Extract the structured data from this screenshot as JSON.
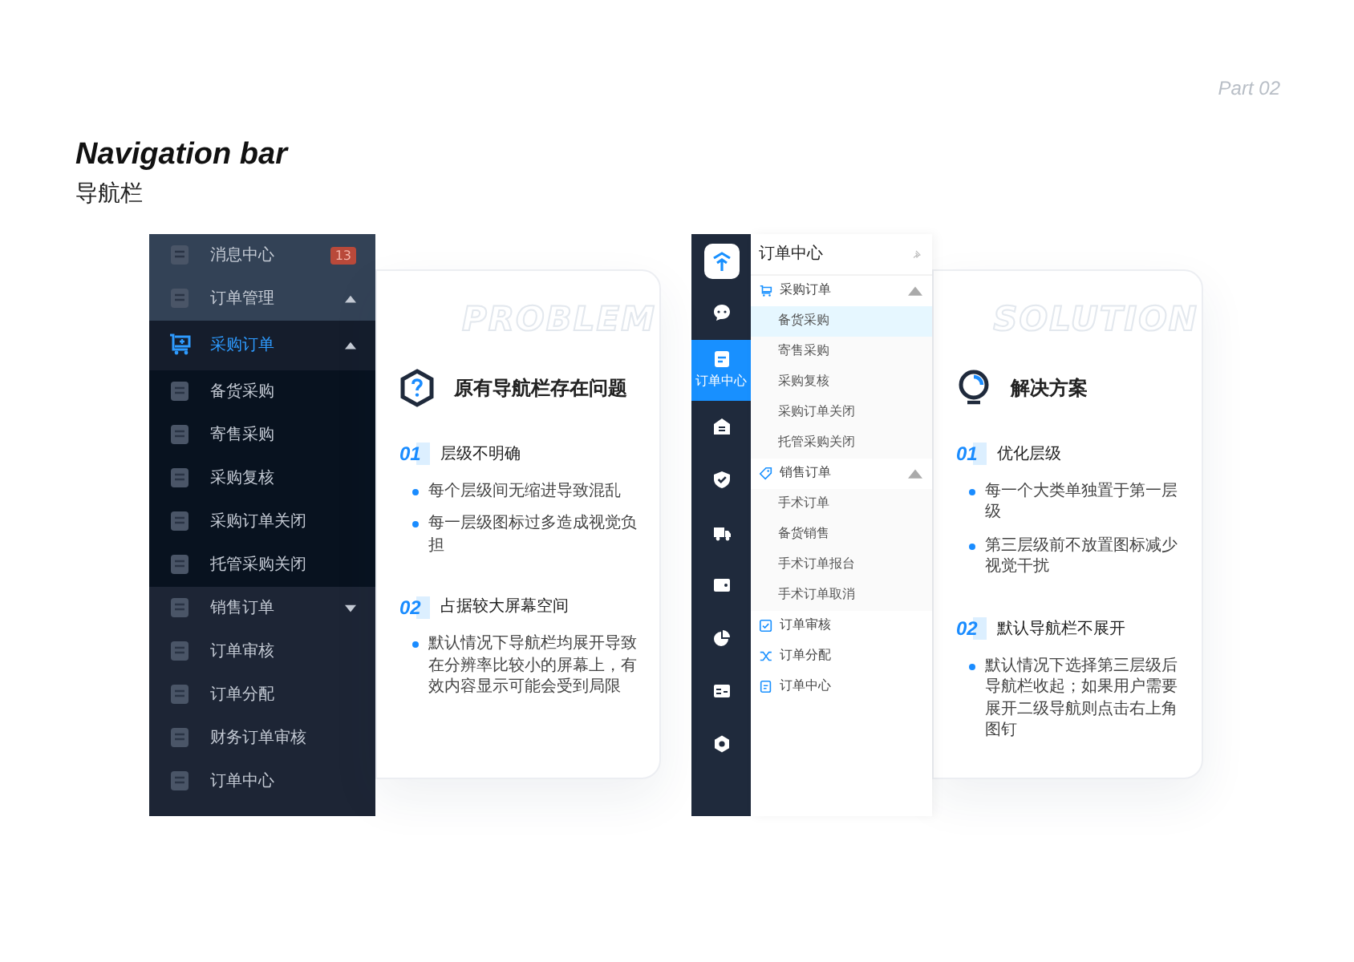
{
  "header": {
    "part": "Part 02",
    "title": "Navigation bar",
    "subtitle": "导航栏"
  },
  "old_nav": {
    "items": [
      {
        "label": "消息中心",
        "badge": "13",
        "selected": false
      },
      {
        "label": "订单管理",
        "expanded": true,
        "selected": false,
        "children": [
          {
            "label": "采购订单",
            "expanded": true,
            "selected": true,
            "children": [
              {
                "label": "备货采购",
                "selected": false
              },
              {
                "label": "寄售采购",
                "selected": false
              },
              {
                "label": "采购复核",
                "selected": false
              },
              {
                "label": "采购订单关闭",
                "selected": false
              },
              {
                "label": "托管采购关闭",
                "selected": false
              }
            ]
          },
          {
            "label": "销售订单",
            "expanded": false,
            "selected": false
          },
          {
            "label": "订单审核",
            "selected": false
          },
          {
            "label": "订单分配",
            "selected": false
          },
          {
            "label": "财务订单审核",
            "selected": false
          },
          {
            "label": "订单中心",
            "selected": false
          }
        ]
      }
    ]
  },
  "problem": {
    "watermark": "PROBLEM",
    "heading": "原有导航栏存在问题",
    "sections": [
      {
        "number": "01",
        "title": "层级不明确",
        "bullets": [
          "每个层级间无缩进导致混乱",
          "每一层级图标过多造成视觉负担"
        ]
      },
      {
        "number": "02",
        "title": "占据较大屏幕空间",
        "bullets": [
          "默认情况下导航栏均展开导致在分辨率比较小的屏幕上，有效内容显示可能会受到局限"
        ]
      }
    ]
  },
  "new_nav": {
    "rail": {
      "items": [
        {
          "selected": false
        },
        {
          "label": "订单中心",
          "selected": true
        },
        {
          "selected": false
        },
        {
          "selected": false
        },
        {
          "selected": false
        },
        {
          "selected": false
        },
        {
          "selected": false
        },
        {
          "selected": false
        },
        {
          "selected": false
        }
      ]
    },
    "submenu": {
      "title": "订单中心",
      "groups": [
        {
          "label": "采购订单",
          "expanded": true,
          "children": [
            {
              "label": "备货采购",
              "selected": true
            },
            {
              "label": "寄售采购",
              "selected": false
            },
            {
              "label": "采购复核",
              "selected": false
            },
            {
              "label": "采购订单关闭",
              "selected": false
            },
            {
              "label": "托管采购关闭",
              "selected": false
            }
          ]
        },
        {
          "label": "销售订单",
          "expanded": true,
          "children": [
            {
              "label": "手术订单",
              "selected": false
            },
            {
              "label": "备货销售",
              "selected": false
            },
            {
              "label": "手术订单报台",
              "selected": false
            },
            {
              "label": "手术订单取消",
              "selected": false
            }
          ]
        },
        {
          "label": "订单审核"
        },
        {
          "label": "订单分配"
        },
        {
          "label": "订单中心"
        }
      ]
    }
  },
  "solution": {
    "watermark": "SOLUTION",
    "heading": "解决方案",
    "sections": [
      {
        "number": "01",
        "title": "优化层级",
        "bullets": [
          "每一个大类单独置于第一层级",
          "第三层级前不放置图标减少视觉干扰"
        ]
      },
      {
        "number": "02",
        "title": "默认导航栏不展开",
        "bullets": [
          "默认情况下选择第三层级后导航栏收起；如果用户需要展开二级导航则点击右上角图钉"
        ]
      }
    ]
  }
}
